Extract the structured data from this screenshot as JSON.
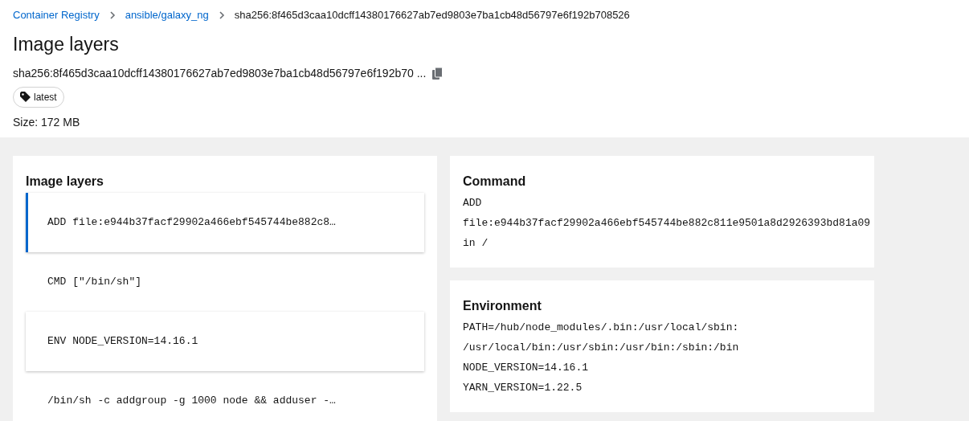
{
  "breadcrumb": [
    {
      "label": "Container Registry",
      "link": true
    },
    {
      "label": "ansible/galaxy_ng",
      "link": true
    },
    {
      "label": "sha256:8f465d3caa10dcff14380176627ab7ed9803e7ba1cb48d56797e6f192b708526",
      "link": false
    }
  ],
  "title": "Image layers",
  "digest": "sha256:8f465d3caa10dcff14380176627ab7ed9803e7ba1cb48d56797e6f192b70 ...",
  "tags": [
    "latest"
  ],
  "size": "Size: 172 MB",
  "layers_panel": {
    "title": "Image layers",
    "layers": [
      {
        "text": "ADD file:e944b37facf29902a466ebf545744be882c8…",
        "selected": true,
        "raised": true
      },
      {
        "text": "CMD [\"/bin/sh\"]",
        "selected": false,
        "raised": false
      },
      {
        "text": "ENV NODE_VERSION=14.16.1",
        "selected": false,
        "raised": true
      },
      {
        "text": "/bin/sh -c addgroup -g 1000 node && adduser -…",
        "selected": false,
        "raised": false
      }
    ]
  },
  "command": {
    "title": "Command",
    "lines": [
      "ADD",
      "file:e944b37facf29902a466ebf545744be882c811e9501a8d2926393bd81a09",
      "in /"
    ]
  },
  "environment": {
    "title": "Environment",
    "lines": [
      "PATH=/hub/node_modules/.bin:/usr/local/sbin:",
      "/usr/local/bin:/usr/sbin:/usr/bin:/sbin:/bin",
      "NODE_VERSION=14.16.1",
      "YARN_VERSION=1.22.5"
    ]
  }
}
